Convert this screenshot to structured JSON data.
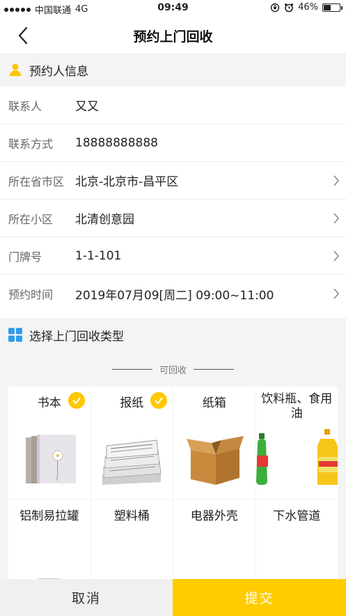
{
  "status_bar": {
    "carrier": "中国联通",
    "network": "4G",
    "time": "09:49",
    "battery_text": "46%",
    "battery_level": 0.46
  },
  "nav": {
    "title": "预约上门回收"
  },
  "contact_section": {
    "title": "预约人信息",
    "rows": [
      {
        "label": "联系人",
        "value": "又又"
      },
      {
        "label": "联系方式",
        "value": "18888888888"
      },
      {
        "label": "所在省市区",
        "value": "北京-北京市-昌平区"
      },
      {
        "label": "所在小区",
        "value": "北清创意园"
      },
      {
        "label": "门牌号",
        "value": "1-1-101"
      },
      {
        "label": "预约时间",
        "value": "2019年07月09[周二] 09:00~11:00"
      }
    ]
  },
  "category_section": {
    "title": "选择上门回收类型",
    "divider_label": "可回收",
    "items": [
      {
        "label": "书本",
        "selected": true
      },
      {
        "label": "报纸",
        "selected": true
      },
      {
        "label": "纸箱",
        "selected": false
      },
      {
        "label": "饮料瓶、食用油",
        "selected": false
      },
      {
        "label": "铝制易拉罐",
        "selected": false
      },
      {
        "label": "塑料桶",
        "selected": false
      },
      {
        "label": "电器外壳",
        "selected": false
      },
      {
        "label": "下水管道",
        "selected": false
      }
    ]
  },
  "actions": {
    "cancel_label": "取消",
    "submit_label": "提交"
  },
  "colors": {
    "accent": "#ffcc00",
    "section_bg": "#f4f4f4",
    "category_icon": "#2d9cf0"
  }
}
